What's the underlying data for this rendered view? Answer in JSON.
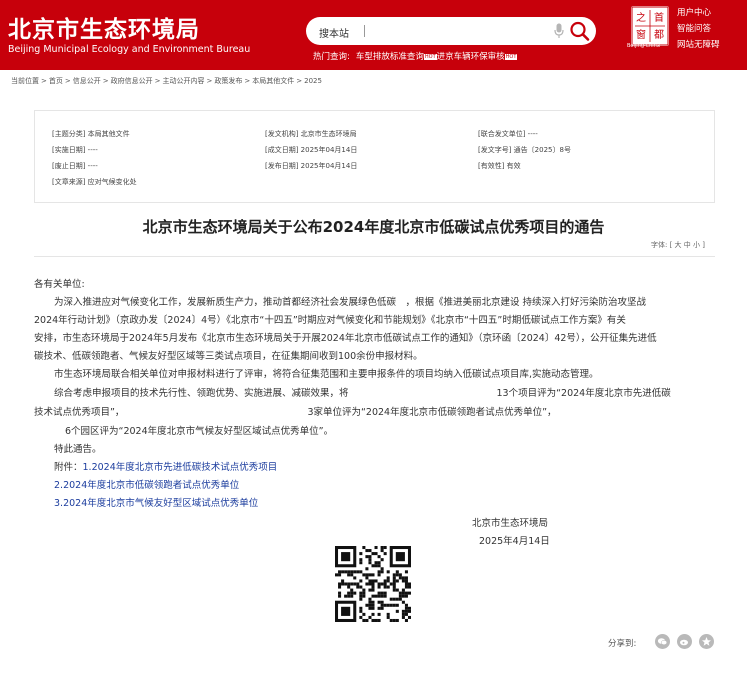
{
  "header": {
    "logo_cn": "北京市生态环境局",
    "logo_en": "Beijing Municipal Ecology and Environment Bureau",
    "search_label": "搜本站",
    "hot_label": "热门查询:",
    "hot_item_1": "车型排放标准查询",
    "hot_item_2": "进京车辆环保审核",
    "hot_tag": "HOT",
    "emblem_text": "Beijing·China",
    "emblem_chars": [
      "之",
      "首",
      "都",
      "窗"
    ],
    "links": [
      "用户中心",
      "智能问答",
      "网站无障碍"
    ],
    "colors": {
      "brand": "#c7000b",
      "link": "#1c3d9e"
    }
  },
  "breadcrumb": [
    "当前位置",
    "首页",
    "信息公开",
    "政府信息公开",
    "主动公开内容",
    "政策发布",
    "本局其他文件",
    "2025"
  ],
  "meta": {
    "col1": [
      "[主题分类] 本局其他文件",
      "[实施日期] ----",
      "[废止日期] ----",
      "[文章来源] 应对气候变化处"
    ],
    "col2": [
      "[发文机构] 北京市生态环境局",
      "[成文日期] 2025年04月14日",
      "[发布日期] 2025年04月14日"
    ],
    "col3": [
      "[联合发文单位] ----",
      "[发文字号] 通告〔2025〕8号",
      "[有效性] 有效"
    ]
  },
  "title": "北京市生态环境局关于公布2024年度北京市低碳试点优秀项目的通告",
  "font_size": {
    "label": "字体:",
    "options": "[ 大 中 小 ]"
  },
  "body": {
    "salutation": "各有关单位:",
    "p1_l1": "为深入推进应对气候变化工作，发展新质生产力，推动首都经济社会发展绿色低碳",
    "p1_l1b": "，根据《推进美丽北京建设 持续深入打好污染防治攻坚战",
    "p1_l2": "2024年行动计划》（京政办发〔2024〕4号）《北京市“十四五”时期应对气候变化和节能规划》《北京市“十四五”时期低碳试点工作方案》有关",
    "p1_l3": "安排，市生态环境局于2024年5月发布《北京市生态环境局关于开展2024年北京市低碳试点工作的通知》（京环函〔2024〕42号），公开征集先进低",
    "p1_l4": "碳技术、低碳领跑者、气候友好型区域等三类试点项目，在征集期间收到100余份申报材料。",
    "p2": "市生态环境局联合相关单位对申报材料进行了评审，将符合征集范围和主要申报条件的项目均纳入低碳试点项目库,实施动态管理。",
    "p3_l1a": "综合考虑申报项目的技术先行性、领跑优势、实施进展、减碳效果，将",
    "p3_l1b": "13个项目评为“2024年度北京市先进低碳",
    "p3_l2a": "技术试点优秀项目”，",
    "p3_l2b": "3家单位评为“2024年度北京市低碳领跑者试点优秀单位”，",
    "p3_l3": "6个园区评为“2024年度北京市气候友好型区域试点优秀单位”。",
    "notice": "特此通告。",
    "attach_label": "附件：",
    "attachments": [
      "1.2024年度北京市先进低碳技术试点优秀项目",
      "2.2024年度北京市低碳领跑者试点优秀单位",
      "3.2024年度北京市气候友好型区域试点优秀单位"
    ],
    "signer": "北京市生态环境局",
    "date": "2025年4月14日"
  },
  "share_label": "分享到:",
  "share_icons": [
    "wechat-icon",
    "weibo-icon",
    "qzone-icon"
  ]
}
